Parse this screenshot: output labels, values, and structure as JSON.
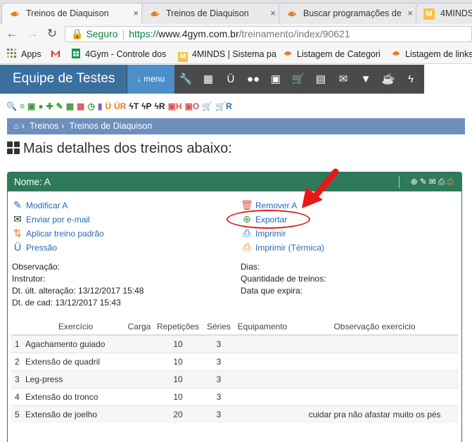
{
  "browser": {
    "tabs": [
      {
        "title": "Treinos de Diaquison",
        "active": true
      },
      {
        "title": "Treinos de Diaquison",
        "active": false
      },
      {
        "title": "Buscar programações de",
        "active": false
      },
      {
        "title": "4MINDS",
        "active": false
      }
    ],
    "close_glyph": "×",
    "secure_label": "Seguro",
    "url_scheme": "https://",
    "url_host": "www.4gym.com.br",
    "url_path": "/treinamento/index/90621",
    "bookmarks": [
      {
        "label": "Apps",
        "icon": "apps-grid-icon"
      },
      {
        "label": "",
        "icon": "gmail-icon"
      },
      {
        "label": "4Gym - Controle dos",
        "icon": "sheets-icon"
      },
      {
        "label": "4MINDS | Sistema pa",
        "icon": "4minds-icon"
      },
      {
        "label": "Listagem de Categori",
        "icon": "fish-icon"
      },
      {
        "label": "Listagem de links",
        "icon": "fish-icon"
      }
    ]
  },
  "app": {
    "brand": "Equipe de Testes",
    "menu_label": "menu",
    "top_icons": [
      "wrench-icon",
      "calendar-icon",
      "stethoscope-icon",
      "users-icon",
      "money-icon",
      "cart-icon",
      "file-icon",
      "envelope-icon",
      "filter-icon",
      "coffee-icon",
      "bolt-icon"
    ],
    "quick_icons": [
      {
        "glyph": "🔍",
        "color": "#3a9a3a",
        "name": "search-icon"
      },
      {
        "glyph": "≡",
        "color": "#3a9a3a",
        "name": "list-icon"
      },
      {
        "glyph": "▣",
        "color": "#3a9a3a",
        "name": "money-icon"
      },
      {
        "glyph": "●",
        "color": "#3a9a3a",
        "name": "user-icon"
      },
      {
        "glyph": "✚",
        "color": "#3a9a3a",
        "name": "users-icon"
      },
      {
        "glyph": "✎",
        "color": "#3a9a3a",
        "name": "pencil-icon"
      },
      {
        "glyph": "▦",
        "color": "#3a9a3a",
        "name": "calendar-icon"
      },
      {
        "glyph": "▦",
        "color": "#d9534f",
        "name": "calendar-red-icon"
      },
      {
        "glyph": "◷",
        "color": "#3a9a3a",
        "name": "clock-icon"
      },
      {
        "glyph": "▮",
        "color": "#8b5bbf",
        "name": "bookmark-icon"
      },
      {
        "glyph": "Ü",
        "color": "#e67e22",
        "name": "stethoscope-icon"
      },
      {
        "glyph": "ÜR",
        "color": "#e67e22",
        "name": "stethoscope-r-icon"
      },
      {
        "glyph": "ϟT",
        "color": "#222",
        "name": "bolt-t-icon"
      },
      {
        "glyph": "ϟP",
        "color": "#222",
        "name": "bolt-p-icon"
      },
      {
        "glyph": "ϟR",
        "color": "#222",
        "name": "bolt-r-icon"
      },
      {
        "glyph": "▣H",
        "color": "#d9534f",
        "name": "money-h-icon"
      },
      {
        "glyph": "▣O",
        "color": "#d9534f",
        "name": "money-o-icon"
      },
      {
        "glyph": "🛒",
        "color": "#2469b3",
        "name": "cart-icon"
      },
      {
        "glyph": "🛒R",
        "color": "#2469b3",
        "name": "cart-r-icon"
      }
    ],
    "breadcrumb": [
      "Treinos",
      "Treinos de Diaquison"
    ],
    "page_title": "Mais detalhes dos treinos abaixo:"
  },
  "panel": {
    "title": "Nome: A",
    "header_icons": [
      "upload-icon",
      "pencil-icon",
      "envelope-icon",
      "print-icon",
      "print-thermal-icon"
    ],
    "actions_left": [
      {
        "label": "Modificar A",
        "icon": "pencil-icon",
        "glyph": "✎",
        "color": "#2469b3"
      },
      {
        "label": "Enviar por e-mail",
        "icon": "envelope-icon",
        "glyph": "✉",
        "color": "#222"
      },
      {
        "label": "Aplicar treino padrão",
        "icon": "sort-icon",
        "glyph": "⇅",
        "color": "#e67e22"
      },
      {
        "label": "Pressão",
        "icon": "stethoscope-icon",
        "glyph": "Ü",
        "color": "#2469b3"
      }
    ],
    "actions_right": [
      {
        "label": "Remover A",
        "icon": "trash-icon",
        "glyph": "🗑",
        "color": "#d9534f"
      },
      {
        "label": "Exportar",
        "icon": "upload-circle-icon",
        "glyph": "⬆",
        "color": "#2f9e4f"
      },
      {
        "label": "Imprimir",
        "icon": "print-icon",
        "glyph": "⎙",
        "color": "#2469b3"
      },
      {
        "label": "Imprimir (Térmica)",
        "icon": "print-thermal-icon",
        "glyph": "⎙",
        "color": "#e67e22"
      }
    ],
    "meta_left": [
      "Observação:",
      "Instrutor:",
      "Dt. últ. alteração: 13/12/2017 15:48",
      "Dt. de cad: 13/12/2017 15:43"
    ],
    "meta_right": [
      "Dias:",
      "Quantidade de treinos:",
      "Data que expira:"
    ],
    "table": {
      "headers": [
        "Exercício",
        "Carga",
        "Repetições",
        "Séries",
        "Equipamento",
        "Observação exercício"
      ],
      "rows": [
        [
          "1",
          "Agachamento guiado",
          "",
          "10",
          "3",
          "",
          ""
        ],
        [
          "2",
          "Extensão de quadril",
          "",
          "10",
          "3",
          "",
          ""
        ],
        [
          "3",
          "Leg-press",
          "",
          "10",
          "3",
          "",
          ""
        ],
        [
          "4",
          "Extensão do tronco",
          "",
          "10",
          "3",
          "",
          ""
        ],
        [
          "5",
          "Extensão de joelho",
          "",
          "20",
          "3",
          "",
          "cuidar pra não afastar muito os pés"
        ]
      ]
    }
  }
}
